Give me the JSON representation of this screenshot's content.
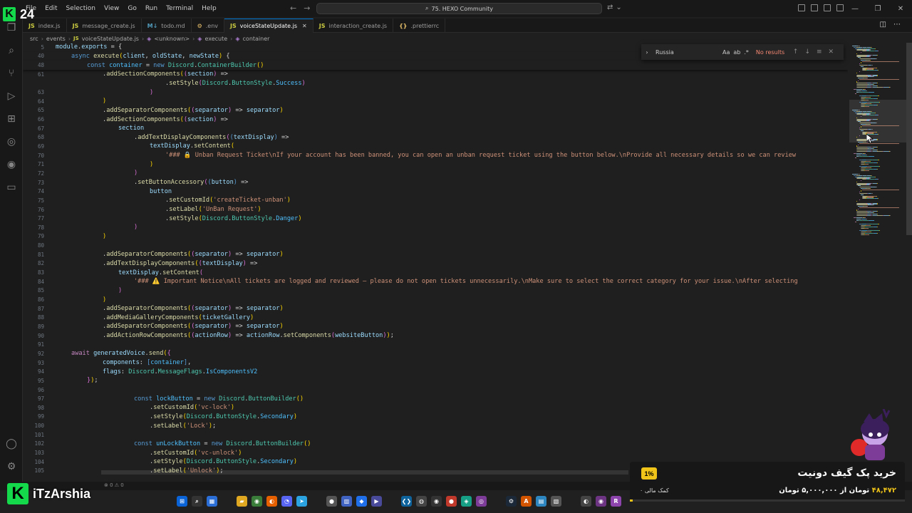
{
  "overlay": {
    "brand_letter": "K",
    "brand_number": "24",
    "streamer_name": "iTzArshia"
  },
  "menu": [
    "File",
    "Edit",
    "Selection",
    "View",
    "Go",
    "Run",
    "Terminal",
    "Help"
  ],
  "search": {
    "label": "75. HEXO Community"
  },
  "tabs": [
    {
      "label": "index.js",
      "icon": "JS",
      "type": "js",
      "active": false
    },
    {
      "label": "message_create.js",
      "icon": "JS",
      "type": "js",
      "active": false
    },
    {
      "label": "todo.md",
      "icon": "M↓",
      "type": "md",
      "active": false
    },
    {
      "label": ".env",
      "icon": "⚙",
      "type": "env",
      "active": false
    },
    {
      "label": "voiceStateUpdate.js",
      "icon": "JS",
      "type": "js",
      "active": true
    },
    {
      "label": "interaction_create.js",
      "icon": "JS",
      "type": "js",
      "active": false
    },
    {
      "label": ".prettierrc",
      "icon": "{}",
      "type": "env",
      "active": false
    }
  ],
  "breadcrumb": [
    "src",
    "events",
    "voiceStateUpdate.js",
    "<unknown>",
    "execute",
    "container"
  ],
  "find": {
    "query": "Russia",
    "result": "No results",
    "options": [
      "Aa",
      "ab",
      ".*"
    ]
  },
  "code_lines": [
    {
      "n": "5",
      "i": 0,
      "t": [
        [
          "v",
          "module"
        ],
        [
          "",
          "."
        ],
        [
          "v",
          "exports"
        ],
        [
          "",
          " = {"
        ]
      ]
    },
    {
      "n": "40",
      "i": 1,
      "t": [
        [
          "b",
          "async"
        ],
        [
          "",
          " "
        ],
        [
          "f",
          "execute"
        ],
        [
          "y",
          "("
        ],
        [
          "v",
          "client"
        ],
        [
          "",
          ", "
        ],
        [
          "v",
          "oldState"
        ],
        [
          "",
          ", "
        ],
        [
          "v",
          "newState"
        ],
        [
          "y",
          ")"
        ],
        [
          "",
          " {"
        ]
      ]
    },
    {
      "n": "48",
      "i": 2,
      "t": [
        [
          "b",
          "const"
        ],
        [
          "",
          " "
        ],
        [
          "c",
          "container"
        ],
        [
          "",
          " = "
        ],
        [
          "b",
          "new"
        ],
        [
          "",
          " "
        ],
        [
          "t",
          "Discord"
        ],
        [
          "",
          "."
        ],
        [
          "t",
          "ContainerBuilder"
        ],
        [
          "y",
          "()"
        ]
      ]
    },
    {
      "n": "61",
      "i": 3,
      "t": [
        [
          "",
          "."
        ],
        [
          "f",
          "addSectionComponents"
        ],
        [
          "y",
          "("
        ],
        [
          "p",
          "("
        ],
        [
          "v",
          "section"
        ],
        [
          "p",
          ")"
        ],
        [
          "",
          " =>"
        ]
      ]
    },
    {
      "n": "",
      "i": 7,
      "t": [
        [
          "",
          "."
        ],
        [
          "f",
          "setStyle"
        ],
        [
          "p",
          "("
        ],
        [
          "t",
          "Discord"
        ],
        [
          "",
          "."
        ],
        [
          "t",
          "ButtonStyle"
        ],
        [
          "",
          "."
        ],
        [
          "c",
          "Success"
        ],
        [
          "p",
          ")"
        ]
      ]
    },
    {
      "n": "63",
      "i": 6,
      "t": [
        [
          "p",
          ")"
        ]
      ]
    },
    {
      "n": "64",
      "i": 3,
      "t": [
        [
          "y",
          ")"
        ]
      ]
    },
    {
      "n": "65",
      "i": 3,
      "t": [
        [
          "",
          "."
        ],
        [
          "f",
          "addSeparatorComponents"
        ],
        [
          "y",
          "("
        ],
        [
          "p",
          "("
        ],
        [
          "v",
          "separator"
        ],
        [
          "p",
          ")"
        ],
        [
          "",
          " => "
        ],
        [
          "v",
          "separator"
        ],
        [
          "y",
          ")"
        ]
      ]
    },
    {
      "n": "66",
      "i": 3,
      "t": [
        [
          "",
          "."
        ],
        [
          "f",
          "addSectionComponents"
        ],
        [
          "y",
          "("
        ],
        [
          "p",
          "("
        ],
        [
          "v",
          "section"
        ],
        [
          "p",
          ")"
        ],
        [
          "",
          " =>"
        ]
      ]
    },
    {
      "n": "67",
      "i": 4,
      "t": [
        [
          "v",
          "section"
        ]
      ]
    },
    {
      "n": "68",
      "i": 5,
      "t": [
        [
          "",
          "."
        ],
        [
          "f",
          "addTextDisplayComponents"
        ],
        [
          "p",
          "("
        ],
        [
          "b",
          "("
        ],
        [
          "v",
          "textDisplay"
        ],
        [
          "b",
          ")"
        ],
        [
          "",
          " =>"
        ]
      ]
    },
    {
      "n": "69",
      "i": 6,
      "t": [
        [
          "v",
          "textDisplay"
        ],
        [
          "",
          "."
        ],
        [
          "f",
          "setContent"
        ],
        [
          "y",
          "("
        ]
      ]
    },
    {
      "n": "70",
      "i": 7,
      "t": [
        [
          "s",
          "'### 🔒 Unban Request Ticket\\nIf your account has been banned, you can open an unban request ticket using the button below.\\nProvide all necessary details so we can review"
        ]
      ]
    },
    {
      "n": "71",
      "i": 6,
      "t": [
        [
          "y",
          ")"
        ]
      ]
    },
    {
      "n": "72",
      "i": 5,
      "t": [
        [
          "p",
          ")"
        ]
      ]
    },
    {
      "n": "73",
      "i": 5,
      "t": [
        [
          "",
          "."
        ],
        [
          "f",
          "setButtonAccessory"
        ],
        [
          "p",
          "("
        ],
        [
          "b",
          "("
        ],
        [
          "v",
          "button"
        ],
        [
          "b",
          ")"
        ],
        [
          "",
          " =>"
        ]
      ]
    },
    {
      "n": "74",
      "i": 6,
      "t": [
        [
          "v",
          "button"
        ]
      ]
    },
    {
      "n": "75",
      "i": 7,
      "t": [
        [
          "",
          "."
        ],
        [
          "f",
          "setCustomId"
        ],
        [
          "y",
          "("
        ],
        [
          "s",
          "'createTicket-unban'"
        ],
        [
          "y",
          ")"
        ]
      ]
    },
    {
      "n": "76",
      "i": 7,
      "t": [
        [
          "",
          "."
        ],
        [
          "f",
          "setLabel"
        ],
        [
          "y",
          "("
        ],
        [
          "s",
          "'UnBan Request'"
        ],
        [
          "y",
          ")"
        ]
      ]
    },
    {
      "n": "77",
      "i": 7,
      "t": [
        [
          "",
          "."
        ],
        [
          "f",
          "setStyle"
        ],
        [
          "y",
          "("
        ],
        [
          "t",
          "Discord"
        ],
        [
          "",
          "."
        ],
        [
          "t",
          "ButtonStyle"
        ],
        [
          "",
          "."
        ],
        [
          "c",
          "Danger"
        ],
        [
          "y",
          ")"
        ]
      ]
    },
    {
      "n": "78",
      "i": 5,
      "t": [
        [
          "p",
          ")"
        ]
      ]
    },
    {
      "n": "79",
      "i": 3,
      "t": [
        [
          "y",
          ")"
        ]
      ]
    },
    {
      "n": "80",
      "i": 0,
      "t": []
    },
    {
      "n": "81",
      "i": 3,
      "t": [
        [
          "",
          "."
        ],
        [
          "f",
          "addSeparatorComponents"
        ],
        [
          "y",
          "("
        ],
        [
          "p",
          "("
        ],
        [
          "v",
          "separator"
        ],
        [
          "p",
          ")"
        ],
        [
          "",
          " => "
        ],
        [
          "v",
          "separator"
        ],
        [
          "y",
          ")"
        ]
      ]
    },
    {
      "n": "82",
      "i": 3,
      "t": [
        [
          "",
          "."
        ],
        [
          "f",
          "addTextDisplayComponents"
        ],
        [
          "y",
          "("
        ],
        [
          "p",
          "("
        ],
        [
          "v",
          "textDisplay"
        ],
        [
          "p",
          ")"
        ],
        [
          "",
          " =>"
        ]
      ]
    },
    {
      "n": "83",
      "i": 4,
      "t": [
        [
          "v",
          "textDisplay"
        ],
        [
          "",
          "."
        ],
        [
          "f",
          "setContent"
        ],
        [
          "p",
          "("
        ]
      ]
    },
    {
      "n": "84",
      "i": 5,
      "t": [
        [
          "s",
          "'### ⚠️ Important Notice\\nAll tickets are logged and reviewed — please do not open tickets unnecessarily.\\nMake sure to select the correct category for your issue.\\nAfter selecting"
        ]
      ]
    },
    {
      "n": "85",
      "i": 4,
      "t": [
        [
          "p",
          ")"
        ]
      ]
    },
    {
      "n": "86",
      "i": 3,
      "t": [
        [
          "y",
          ")"
        ]
      ]
    },
    {
      "n": "87",
      "i": 3,
      "t": [
        [
          "",
          "."
        ],
        [
          "f",
          "addSeparatorComponents"
        ],
        [
          "y",
          "("
        ],
        [
          "p",
          "("
        ],
        [
          "v",
          "separator"
        ],
        [
          "p",
          ")"
        ],
        [
          "",
          " => "
        ],
        [
          "v",
          "separator"
        ],
        [
          "y",
          ")"
        ]
      ]
    },
    {
      "n": "88",
      "i": 3,
      "t": [
        [
          "",
          "."
        ],
        [
          "f",
          "addMediaGalleryComponents"
        ],
        [
          "y",
          "("
        ],
        [
          "v",
          "ticketGallery"
        ],
        [
          "y",
          ")"
        ]
      ]
    },
    {
      "n": "89",
      "i": 3,
      "t": [
        [
          "",
          "."
        ],
        [
          "f",
          "addSeparatorComponents"
        ],
        [
          "y",
          "("
        ],
        [
          "p",
          "("
        ],
        [
          "v",
          "separator"
        ],
        [
          "p",
          ")"
        ],
        [
          "",
          " => "
        ],
        [
          "v",
          "separator"
        ],
        [
          "y",
          ")"
        ]
      ]
    },
    {
      "n": "90",
      "i": 3,
      "t": [
        [
          "",
          "."
        ],
        [
          "f",
          "addActionRowComponents"
        ],
        [
          "y",
          "("
        ],
        [
          "p",
          "("
        ],
        [
          "v",
          "actionRow"
        ],
        [
          "p",
          ")"
        ],
        [
          "",
          " => "
        ],
        [
          "v",
          "actionRow"
        ],
        [
          "",
          "."
        ],
        [
          "f",
          "setComponents"
        ],
        [
          "p",
          "("
        ],
        [
          "v",
          "websiteButton"
        ],
        [
          "p",
          ")"
        ],
        [
          "y",
          ")"
        ],
        [
          "",
          ";"
        ]
      ]
    },
    {
      "n": "91",
      "i": 0,
      "t": []
    },
    {
      "n": "92",
      "i": 1,
      "t": [
        [
          "k",
          "await"
        ],
        [
          "",
          " "
        ],
        [
          "v",
          "generatedVoice"
        ],
        [
          "",
          "."
        ],
        [
          "f",
          "send"
        ],
        [
          "y",
          "("
        ],
        [
          "p",
          "{"
        ]
      ]
    },
    {
      "n": "93",
      "i": 3,
      "t": [
        [
          "v",
          "components"
        ],
        [
          "",
          ": "
        ],
        [
          "b",
          "["
        ],
        [
          "c",
          "container"
        ],
        [
          "b",
          "]"
        ],
        [
          "",
          ","
        ]
      ]
    },
    {
      "n": "94",
      "i": 3,
      "t": [
        [
          "v",
          "flags"
        ],
        [
          "",
          ": "
        ],
        [
          "t",
          "Discord"
        ],
        [
          "",
          "."
        ],
        [
          "t",
          "MessageFlags"
        ],
        [
          "",
          "."
        ],
        [
          "c",
          "IsComponentsV2"
        ]
      ]
    },
    {
      "n": "95",
      "i": 2,
      "t": [
        [
          "p",
          "}"
        ],
        [
          "y",
          ")"
        ],
        [
          "",
          ";"
        ]
      ]
    },
    {
      "n": "96",
      "i": 0,
      "t": []
    },
    {
      "n": "97",
      "i": 5,
      "t": [
        [
          "b",
          "const"
        ],
        [
          "",
          " "
        ],
        [
          "c",
          "lockButton"
        ],
        [
          "",
          " = "
        ],
        [
          "b",
          "new"
        ],
        [
          "",
          " "
        ],
        [
          "t",
          "Discord"
        ],
        [
          "",
          "."
        ],
        [
          "t",
          "ButtonBuilder"
        ],
        [
          "y",
          "()"
        ]
      ]
    },
    {
      "n": "98",
      "i": 6,
      "t": [
        [
          "",
          "."
        ],
        [
          "f",
          "setCustomId"
        ],
        [
          "y",
          "("
        ],
        [
          "s",
          "'vc-lock'"
        ],
        [
          "y",
          ")"
        ]
      ]
    },
    {
      "n": "99",
      "i": 6,
      "t": [
        [
          "",
          "."
        ],
        [
          "f",
          "setStyle"
        ],
        [
          "y",
          "("
        ],
        [
          "t",
          "Discord"
        ],
        [
          "",
          "."
        ],
        [
          "t",
          "ButtonStyle"
        ],
        [
          "",
          "."
        ],
        [
          "c",
          "Secondary"
        ],
        [
          "y",
          ")"
        ]
      ]
    },
    {
      "n": "100",
      "i": 6,
      "t": [
        [
          "",
          "."
        ],
        [
          "f",
          "setLabel"
        ],
        [
          "y",
          "("
        ],
        [
          "s",
          "'Lock'"
        ],
        [
          "y",
          ")"
        ],
        [
          "",
          ";"
        ]
      ]
    },
    {
      "n": "101",
      "i": 0,
      "t": []
    },
    {
      "n": "102",
      "i": 5,
      "t": [
        [
          "b",
          "const"
        ],
        [
          "",
          " "
        ],
        [
          "c",
          "unLockButton"
        ],
        [
          "",
          " = "
        ],
        [
          "b",
          "new"
        ],
        [
          "",
          " "
        ],
        [
          "t",
          "Discord"
        ],
        [
          "",
          "."
        ],
        [
          "t",
          "ButtonBuilder"
        ],
        [
          "y",
          "()"
        ]
      ]
    },
    {
      "n": "103",
      "i": 6,
      "t": [
        [
          "",
          "."
        ],
        [
          "f",
          "setCustomId"
        ],
        [
          "y",
          "("
        ],
        [
          "s",
          "'vc-unlock'"
        ],
        [
          "y",
          ")"
        ]
      ]
    },
    {
      "n": "104",
      "i": 6,
      "t": [
        [
          "",
          "."
        ],
        [
          "f",
          "setStyle"
        ],
        [
          "y",
          "("
        ],
        [
          "t",
          "Discord"
        ],
        [
          "",
          "."
        ],
        [
          "t",
          "ButtonStyle"
        ],
        [
          "",
          "."
        ],
        [
          "c",
          "Secondary"
        ],
        [
          "y",
          ")"
        ]
      ]
    },
    {
      "n": "105",
      "i": 6,
      "t": [
        [
          "",
          "."
        ],
        [
          "f",
          "setLabel"
        ],
        [
          "y",
          "("
        ],
        [
          "s",
          "'Unlock'"
        ],
        [
          "y",
          ")"
        ],
        [
          "",
          ";"
        ]
      ]
    }
  ],
  "status": {
    "problems": "⊗ 0 ⚠ 0"
  },
  "donate": {
    "percent": "1%",
    "supporters": "۰ کمک مالی",
    "title": "خرید پک گیف دونیت",
    "price_amount": "۴۸,۴۷۲",
    "price_text": "تومان از ۵,۰۰۰,۰۰۰ تومان",
    "progress": 0.01
  },
  "colors": {
    "accent": "#0078d4",
    "editor_bg": "#1f1f1f",
    "brand_green": "#14d94a",
    "donate_yellow": "#f0c419"
  }
}
